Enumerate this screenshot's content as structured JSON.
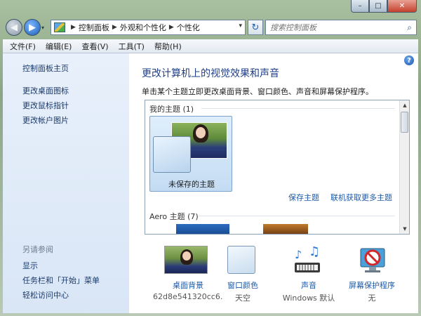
{
  "window": {
    "caption": {
      "minimize": "–",
      "maximize": "□",
      "close": "✕"
    }
  },
  "nav": {
    "back_glyph": "◀",
    "forward_glyph": "▶",
    "dropdown_glyph": "▾",
    "breadcrumbs": [
      "控制面板",
      "外观和个性化",
      "个性化"
    ],
    "refresh_glyph": "↻",
    "search_placeholder": "搜索控制面板"
  },
  "menubar": {
    "items": [
      "文件(F)",
      "编辑(E)",
      "查看(V)",
      "工具(T)",
      "帮助(H)"
    ]
  },
  "sidebar": {
    "home": "控制面板主页",
    "links": [
      "更改桌面图标",
      "更改鼠标指针",
      "更改帐户图片"
    ],
    "see_also_heading": "另请参阅",
    "see_also": [
      "显示",
      "任务栏和「开始」菜单",
      "轻松访问中心"
    ]
  },
  "main": {
    "title": "更改计算机上的视觉效果和声音",
    "description": "单击某个主题立即更改桌面背景、窗口颜色、声音和屏幕保护程序。",
    "help": "?"
  },
  "themes": {
    "my_themes_label": "我的主题 (1)",
    "unsaved_theme": "未保存的主题",
    "save_theme": "保存主题",
    "get_more_online": "联机获取更多主题",
    "aero_label": "Aero 主题 (7)"
  },
  "bottom": [
    {
      "label": "桌面背景",
      "value": "62d8e541320cc6..."
    },
    {
      "label": "窗口颜色",
      "value": "天空"
    },
    {
      "label": "声音",
      "value": "Windows 默认"
    },
    {
      "label": "屏幕保护程序",
      "value": "无"
    }
  ],
  "colors": {
    "link": "#1e5aa8",
    "title": "#1e3f8a",
    "sidebar_bg": "#e8f0fb"
  }
}
